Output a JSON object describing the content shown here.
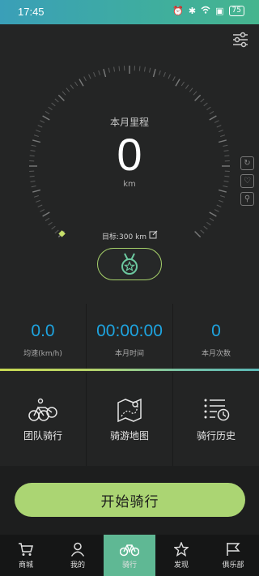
{
  "status_bar": {
    "time": "17:45",
    "battery": "75"
  },
  "dial": {
    "label": "本月里程",
    "value": "0",
    "unit": "km",
    "goal_text": "目标:300 km"
  },
  "stats": [
    {
      "value": "0.0",
      "label": "均速(km/h)"
    },
    {
      "value": "00:00:00",
      "label": "本月时间"
    },
    {
      "value": "0",
      "label": "本月次数"
    }
  ],
  "tiles": [
    {
      "label": "团队骑行",
      "icon": "team-ride-icon"
    },
    {
      "label": "骑游地图",
      "icon": "ride-map-icon"
    },
    {
      "label": "骑行历史",
      "icon": "ride-history-icon"
    }
  ],
  "start_button": {
    "label": "开始骑行"
  },
  "nav": [
    {
      "label": "商城",
      "icon": "cart-icon"
    },
    {
      "label": "我的",
      "icon": "person-icon"
    },
    {
      "label": "骑行",
      "icon": "bike-icon",
      "active": true
    },
    {
      "label": "发现",
      "icon": "star-icon"
    },
    {
      "label": "俱乐部",
      "icon": "flag-icon"
    }
  ],
  "colors": {
    "accent_green": "#abd573",
    "stat_blue": "#1ea4e0",
    "nav_active": "#5fb894"
  }
}
